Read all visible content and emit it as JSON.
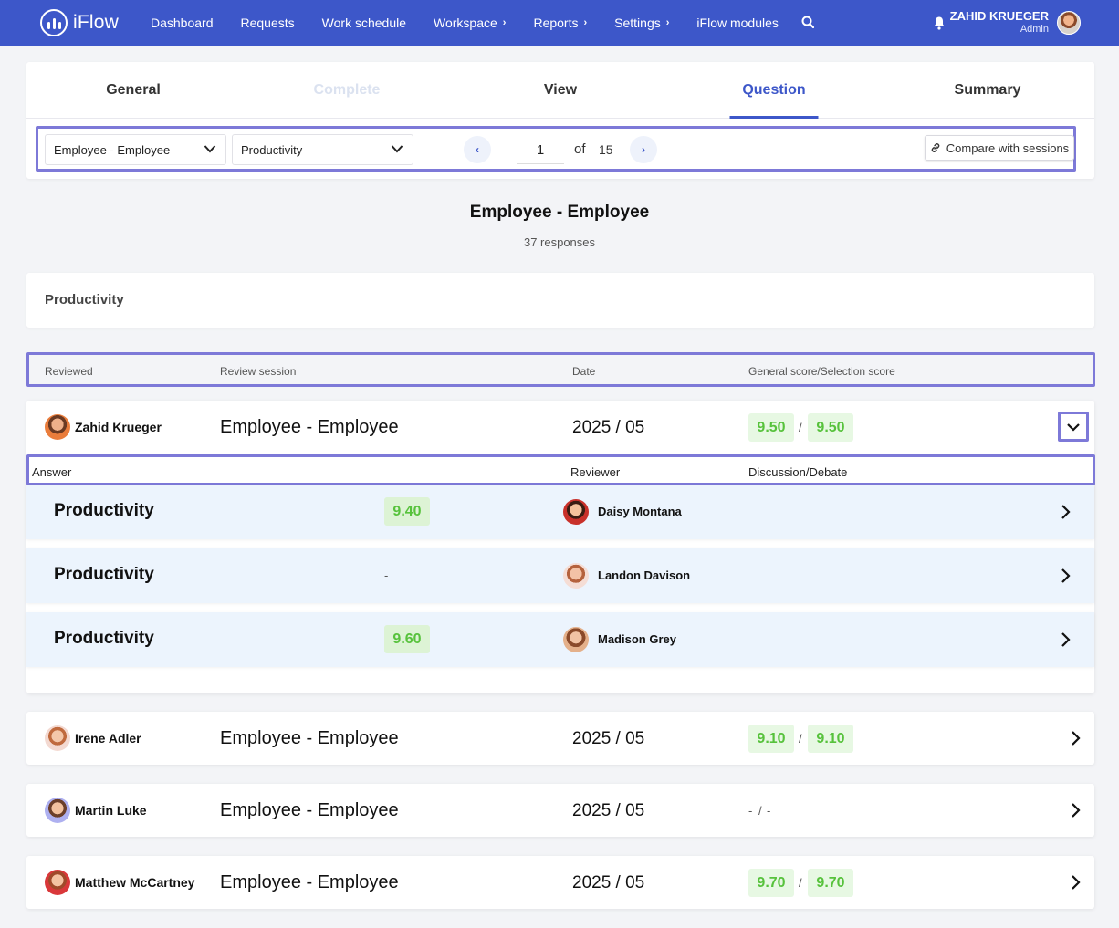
{
  "app": {
    "name": "iFlow"
  },
  "nav": {
    "items": [
      {
        "label": "Dashboard",
        "has_menu": false
      },
      {
        "label": "Requests",
        "has_menu": false
      },
      {
        "label": "Work schedule",
        "has_menu": false
      },
      {
        "label": "Workspace",
        "has_menu": true
      },
      {
        "label": "Reports",
        "has_menu": true
      },
      {
        "label": "Settings",
        "has_menu": true
      },
      {
        "label": "iFlow modules",
        "has_menu": false
      }
    ]
  },
  "user": {
    "name": "ZAHID KRUEGER",
    "role": "Admin"
  },
  "tabs": [
    {
      "label": "General",
      "state": "normal"
    },
    {
      "label": "Complete",
      "state": "disabled"
    },
    {
      "label": "View",
      "state": "normal"
    },
    {
      "label": "Question",
      "state": "active"
    },
    {
      "label": "Summary",
      "state": "normal"
    }
  ],
  "toolbar": {
    "session_select": "Employee - Employee",
    "question_select": "Productivity",
    "page_current": "1",
    "page_of": "of",
    "page_total": "15",
    "compare_label": "Compare with sessions"
  },
  "heading": {
    "title": "Employee - Employee",
    "responses": "37 responses"
  },
  "question_card": {
    "label": "Productivity"
  },
  "columns": {
    "reviewed": "Reviewed",
    "session": "Review session",
    "date": "Date",
    "score": "General score/Selection score"
  },
  "sub_columns": {
    "answer": "Answer",
    "reviewer": "Reviewer",
    "discussion": "Discussion/Debate"
  },
  "rows": [
    {
      "name": "Zahid Krueger",
      "session": "Employee - Employee",
      "date": "2025 / 05",
      "general": "9.50",
      "selection": "9.50",
      "expanded": true
    },
    {
      "name": "Irene Adler",
      "session": "Employee - Employee",
      "date": "2025 / 05",
      "general": "9.10",
      "selection": "9.10",
      "expanded": false
    },
    {
      "name": "Martin Luke",
      "session": "Employee - Employee",
      "date": "2025 / 05",
      "general": "-",
      "selection": "-",
      "expanded": false
    },
    {
      "name": "Matthew McCartney",
      "session": "Employee - Employee",
      "date": "2025 / 05",
      "general": "9.70",
      "selection": "9.70",
      "expanded": false
    }
  ],
  "answers": [
    {
      "label": "Productivity",
      "score": "9.40",
      "reviewer": "Daisy Montana"
    },
    {
      "label": "Productivity",
      "score": "-",
      "reviewer": "Landon Davison"
    },
    {
      "label": "Productivity",
      "score": "9.60",
      "reviewer": "Madison Grey"
    }
  ],
  "slash": "/",
  "colors": {
    "brand": "#3d57c9",
    "score_bg": "#e7f8e3",
    "score_text": "#57c23c",
    "highlight_border": "#7d79d8"
  }
}
